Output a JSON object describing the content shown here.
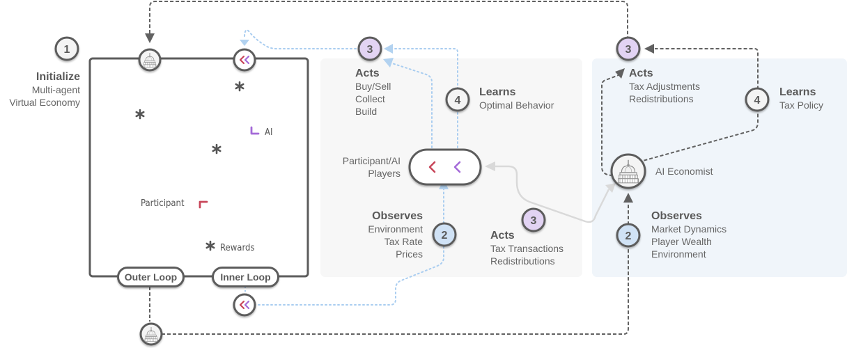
{
  "colors": {
    "stroke_dark": "#5c5c5c",
    "dashed_dark": "#616161",
    "dotted_blue": "#a9cdf0",
    "arrow_blue": "#b2d2f0",
    "connector_gray": "#d9d9d9",
    "badge_purple": "#e2d3f3",
    "badge_blue": "#d0e2f5",
    "badge_white": "#f4f4f4",
    "panel_gray": "#f7f7f7",
    "panel_blue": "#f0f5fa",
    "participant_red": "#c8465a",
    "ai_purple": "#a46ad8",
    "star_gray": "#555555"
  },
  "step1": {
    "badge": "1",
    "title": "Initialize",
    "lines": [
      "Multi-agent",
      "Virtual Economy"
    ]
  },
  "environment": {
    "labels": {
      "ai": "AI",
      "participant": "Participant",
      "rewards": "Rewards"
    },
    "loops": {
      "outer": "Outer Loop",
      "inner": "Inner Loop"
    }
  },
  "inner_panel": {
    "acts": {
      "badge": "3",
      "title": "Acts",
      "lines": [
        "Buy/Sell",
        "Collect",
        "Build"
      ]
    },
    "learns": {
      "badge": "4",
      "title": "Learns",
      "lines": [
        "Optimal Behavior"
      ]
    },
    "players": {
      "lines": [
        "Participant/AI",
        "Players"
      ]
    },
    "observes": {
      "badge": "2",
      "title": "Observes",
      "lines": [
        "Environment",
        "Tax Rate",
        "Prices"
      ]
    },
    "acts_tax": {
      "badge": "3",
      "title": "Acts",
      "lines": [
        "Tax Transactions",
        "Redistributions"
      ]
    }
  },
  "outer_panel": {
    "acts": {
      "badge": "3",
      "title": "Acts",
      "lines": [
        "Tax Adjustments",
        "Redistributions"
      ]
    },
    "learns": {
      "badge": "4",
      "title": "Learns",
      "lines": [
        "Tax Policy"
      ]
    },
    "economist": {
      "label": "AI Economist"
    },
    "observes": {
      "badge": "2",
      "title": "Observes",
      "lines": [
        "Market Dynamics",
        "Player Wealth",
        "Environment"
      ]
    }
  },
  "icons": {
    "capitol": "capitol-building-icon",
    "chevrons": "double-chevron-icon",
    "star": "asterisk-icon"
  }
}
